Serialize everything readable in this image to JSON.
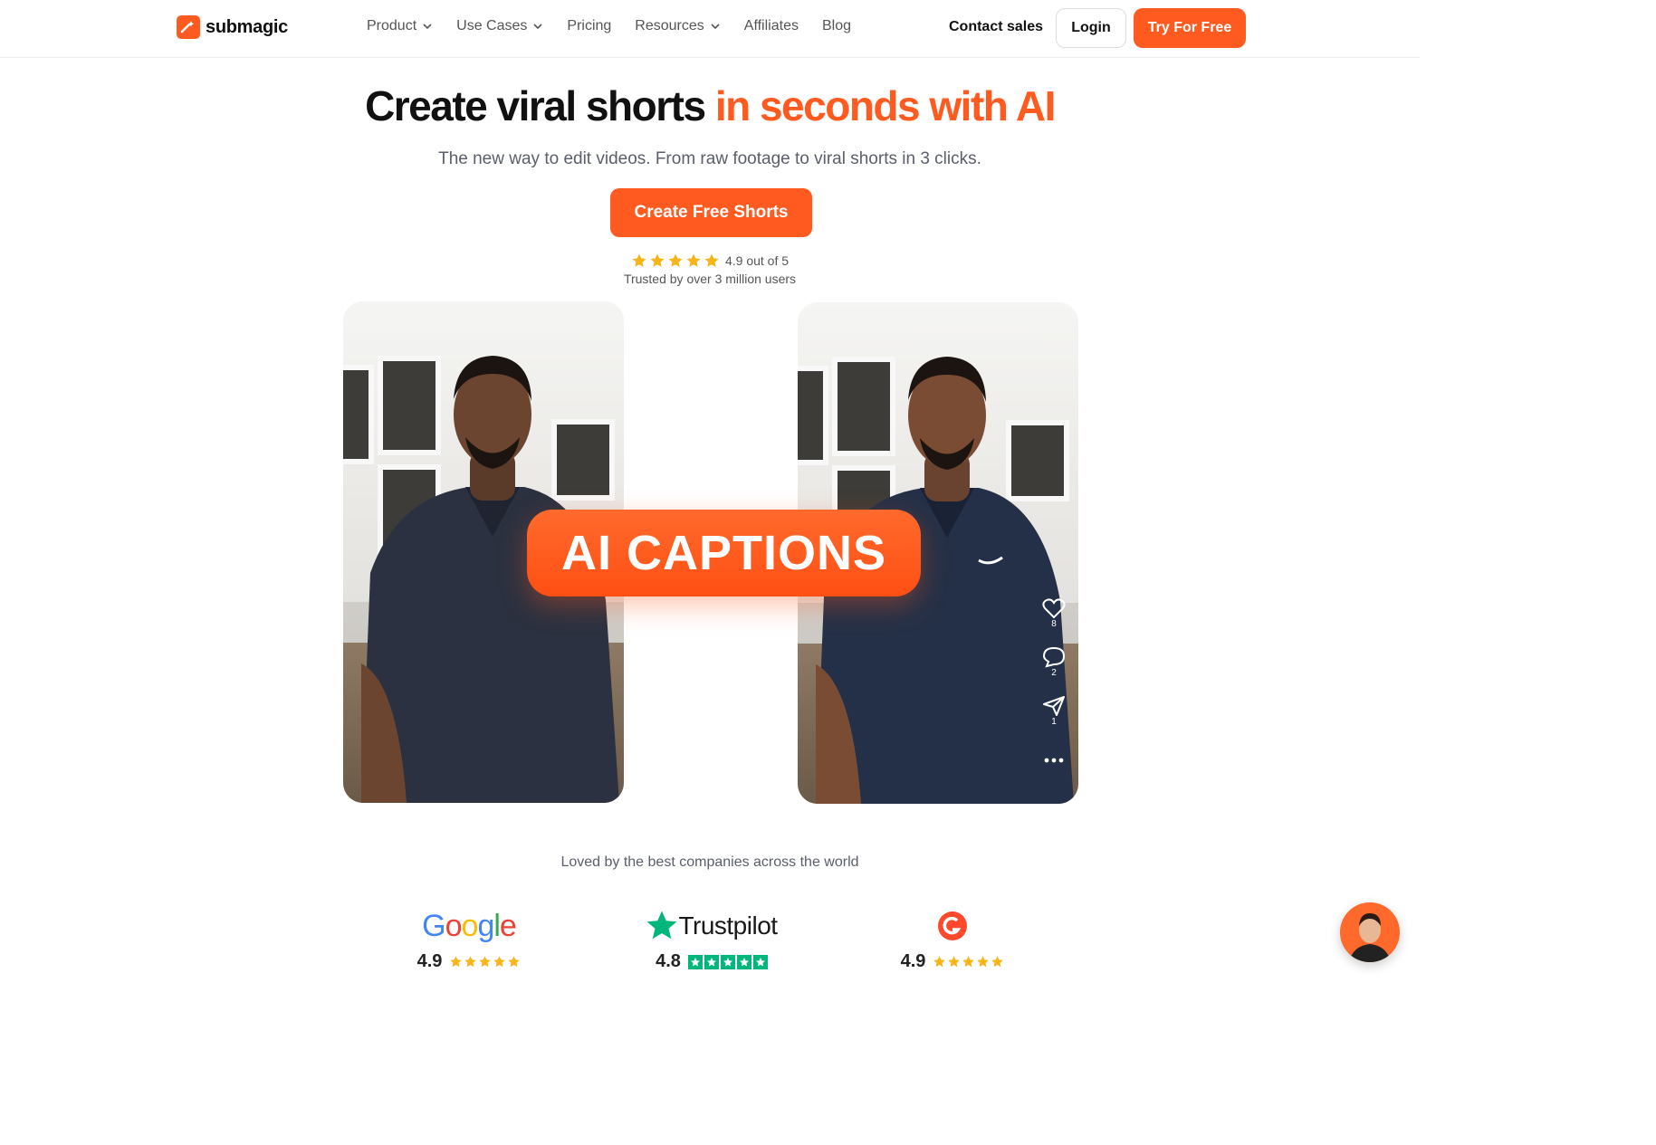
{
  "brand": {
    "name": "submagic",
    "accent": "#ff5a1f"
  },
  "nav": {
    "links": [
      {
        "label": "Product",
        "dropdown": true
      },
      {
        "label": "Use Cases",
        "dropdown": true
      },
      {
        "label": "Pricing",
        "dropdown": false
      },
      {
        "label": "Resources",
        "dropdown": true
      },
      {
        "label": "Affiliates",
        "dropdown": false
      },
      {
        "label": "Blog",
        "dropdown": false
      }
    ],
    "contact": "Contact sales",
    "login": "Login",
    "try": "Try For Free"
  },
  "hero": {
    "title_black": "Create viral shorts",
    "title_orange": "in seconds with AI",
    "subtitle": "The new way to edit videos. From raw footage to viral shorts in 3 clicks.",
    "cta": "Create Free Shorts",
    "rating_value": 4.9,
    "rating_text": "4.9 out of 5",
    "trusted": "Trusted by over 3 million users"
  },
  "video": {
    "caption": "AI CAPTIONS",
    "likes": "8",
    "comments": "2",
    "shares": "1"
  },
  "social_proof": {
    "heading": "Loved by the best companies across the world",
    "reviews": [
      {
        "name": "Google",
        "score": "4.9",
        "icon": "google-logo"
      },
      {
        "name": "Trustpilot",
        "score": "4.8",
        "icon": "trustpilot-logo"
      },
      {
        "name": "G2",
        "score": "4.9",
        "icon": "g2-logo"
      }
    ]
  }
}
